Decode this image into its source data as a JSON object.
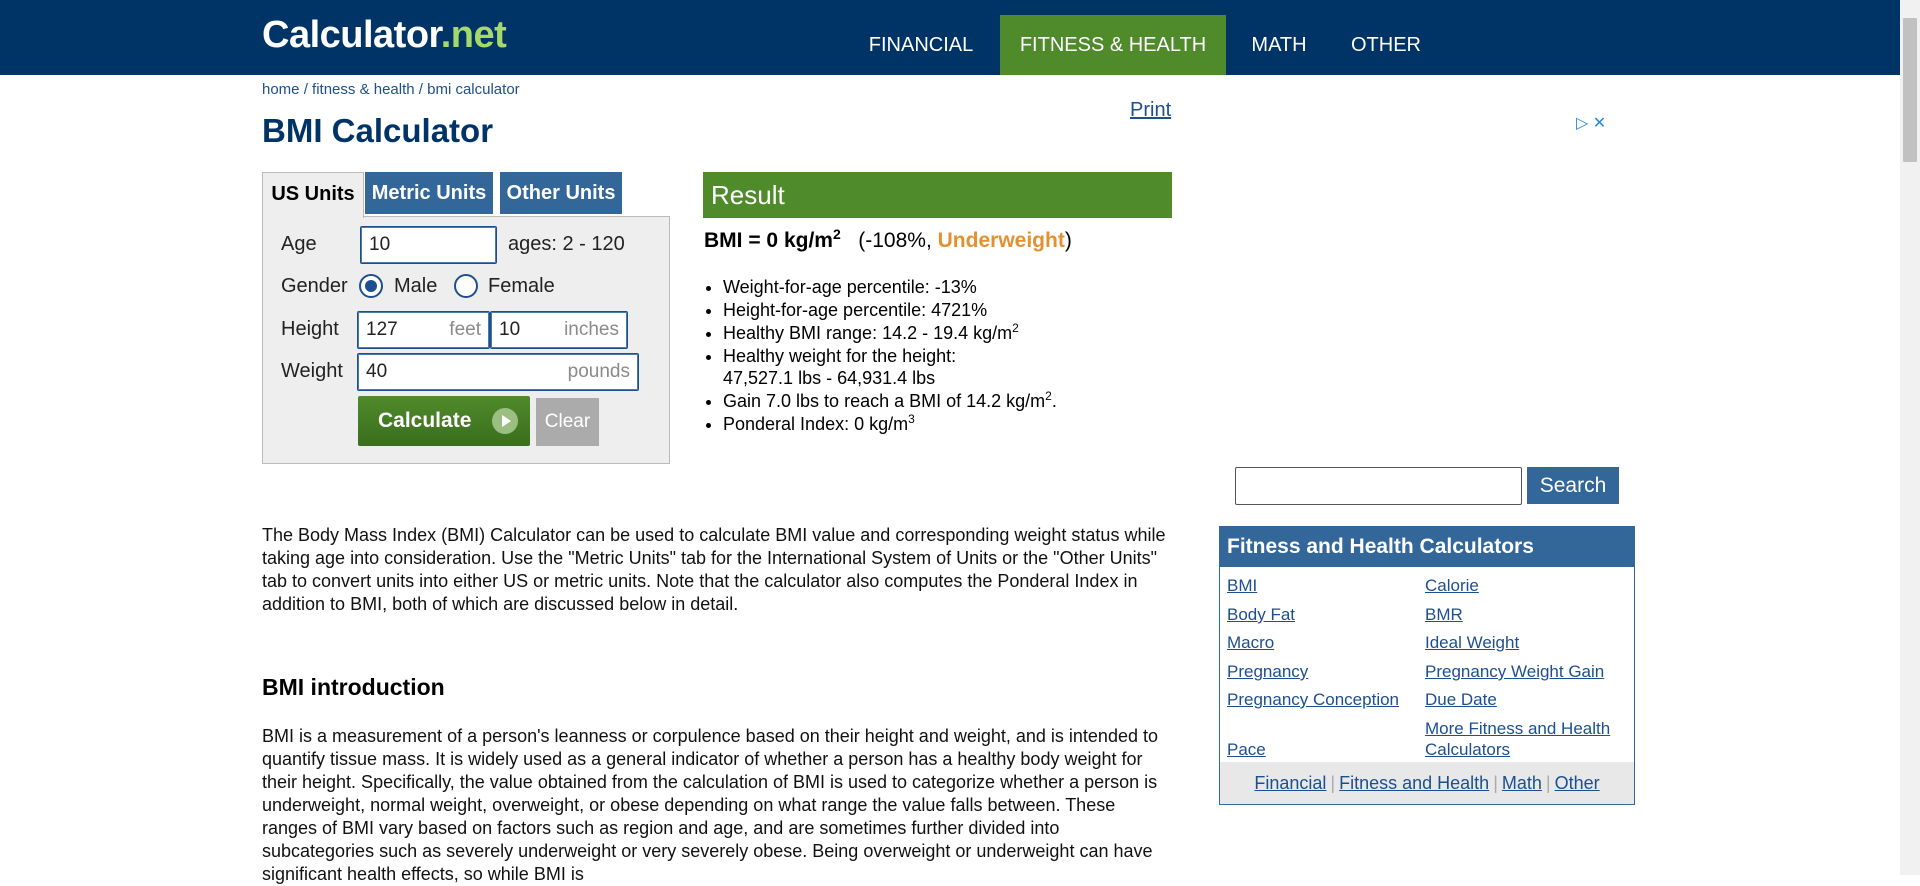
{
  "logo": {
    "part1": "Calculator",
    "part2": ".net"
  },
  "nav": {
    "items": [
      "FINANCIAL",
      "FITNESS & HEALTH",
      "MATH",
      "OTHER"
    ],
    "active": "FITNESS & HEALTH"
  },
  "breadcrumb": {
    "home": "home",
    "sep": " / ",
    "section": "fitness & health",
    "current": "bmi calculator"
  },
  "print_label": "Print",
  "page_title": "BMI Calculator",
  "tabs": [
    "US Units",
    "Metric Units",
    "Other Units"
  ],
  "form": {
    "age_label": "Age",
    "age_value": "10",
    "age_hint": "ages: 2 - 120",
    "gender_label": "Gender",
    "gender_male": "Male",
    "gender_female": "Female",
    "gender_selected": "Male",
    "height_label": "Height",
    "height_feet": "127",
    "feet_unit": "feet",
    "height_inches": "10",
    "inches_unit": "inches",
    "weight_label": "Weight",
    "weight_value": "40",
    "weight_unit": "pounds",
    "calculate_label": "Calculate",
    "clear_label": "Clear"
  },
  "result": {
    "header": "Result",
    "bmi_text": "BMI = 0 kg/m",
    "bmi_sup": "2",
    "pct_text": "(-108%, ",
    "status": "Underweight",
    "close_paren": ")",
    "items": [
      {
        "text": "Weight-for-age percentile: -13%"
      },
      {
        "text": "Height-for-age percentile: 4721%"
      },
      {
        "text": "Healthy BMI range: 14.2 - 19.4 kg/m",
        "sup": "2"
      },
      {
        "text": "Healthy weight for the height:",
        "line2": "47,527.1 lbs - 64,931.4 lbs"
      },
      {
        "text": "Gain 7.0 lbs to reach a BMI of 14.2 kg/m",
        "sup": "2",
        "suffix": "."
      },
      {
        "text": "Ponderal Index: 0 kg/m",
        "sup": "3"
      }
    ]
  },
  "content": {
    "p1": "The Body Mass Index (BMI) Calculator can be used to calculate BMI value and corresponding weight status while taking age into consideration. Use the \"Metric Units\" tab for the International System of Units or the \"Other Units\" tab to convert units into either US or metric units. Note that the calculator also computes the Ponderal Index in addition to BMI, both of which are discussed below in detail.",
    "intro_heading": "BMI introduction",
    "p2": "BMI is a measurement of a person's leanness or corpulence based on their height and weight, and is intended to quantify tissue mass. It is widely used as a general indicator of whether a person has a healthy body weight for their height. Specifically, the value obtained from the calculation of BMI is used to categorize whether a person is underweight, normal weight, overweight, or obese depending on what range the value falls between. These ranges of BMI vary based on factors such as region and age, and are sometimes further divided into subcategories such as severely underweight or very severely obese. Being overweight or underweight can have significant health effects, so while BMI is"
  },
  "ad_icons": {
    "play": "▷",
    "close": "✕"
  },
  "search": {
    "value": "",
    "button": "Search"
  },
  "sidebar": {
    "title": "Fitness and Health Calculators",
    "left_links": [
      "BMI",
      "Body Fat",
      "Macro",
      "Pregnancy",
      "Pregnancy Conception",
      "Pace"
    ],
    "right_links": [
      "Calorie",
      "BMR",
      "Ideal Weight",
      "Pregnancy Weight Gain",
      "Due Date",
      "More Fitness and Health Calculators"
    ],
    "footer_links": [
      "Financial",
      "Fitness and Health",
      "Math",
      "Other"
    ],
    "footer_sep": "|"
  },
  "colors": {
    "header_bg": "#003366",
    "active_nav": "#4f8a2b",
    "tab_blue": "#336699",
    "status_orange": "#e39130",
    "link": "#1d4f8f"
  }
}
